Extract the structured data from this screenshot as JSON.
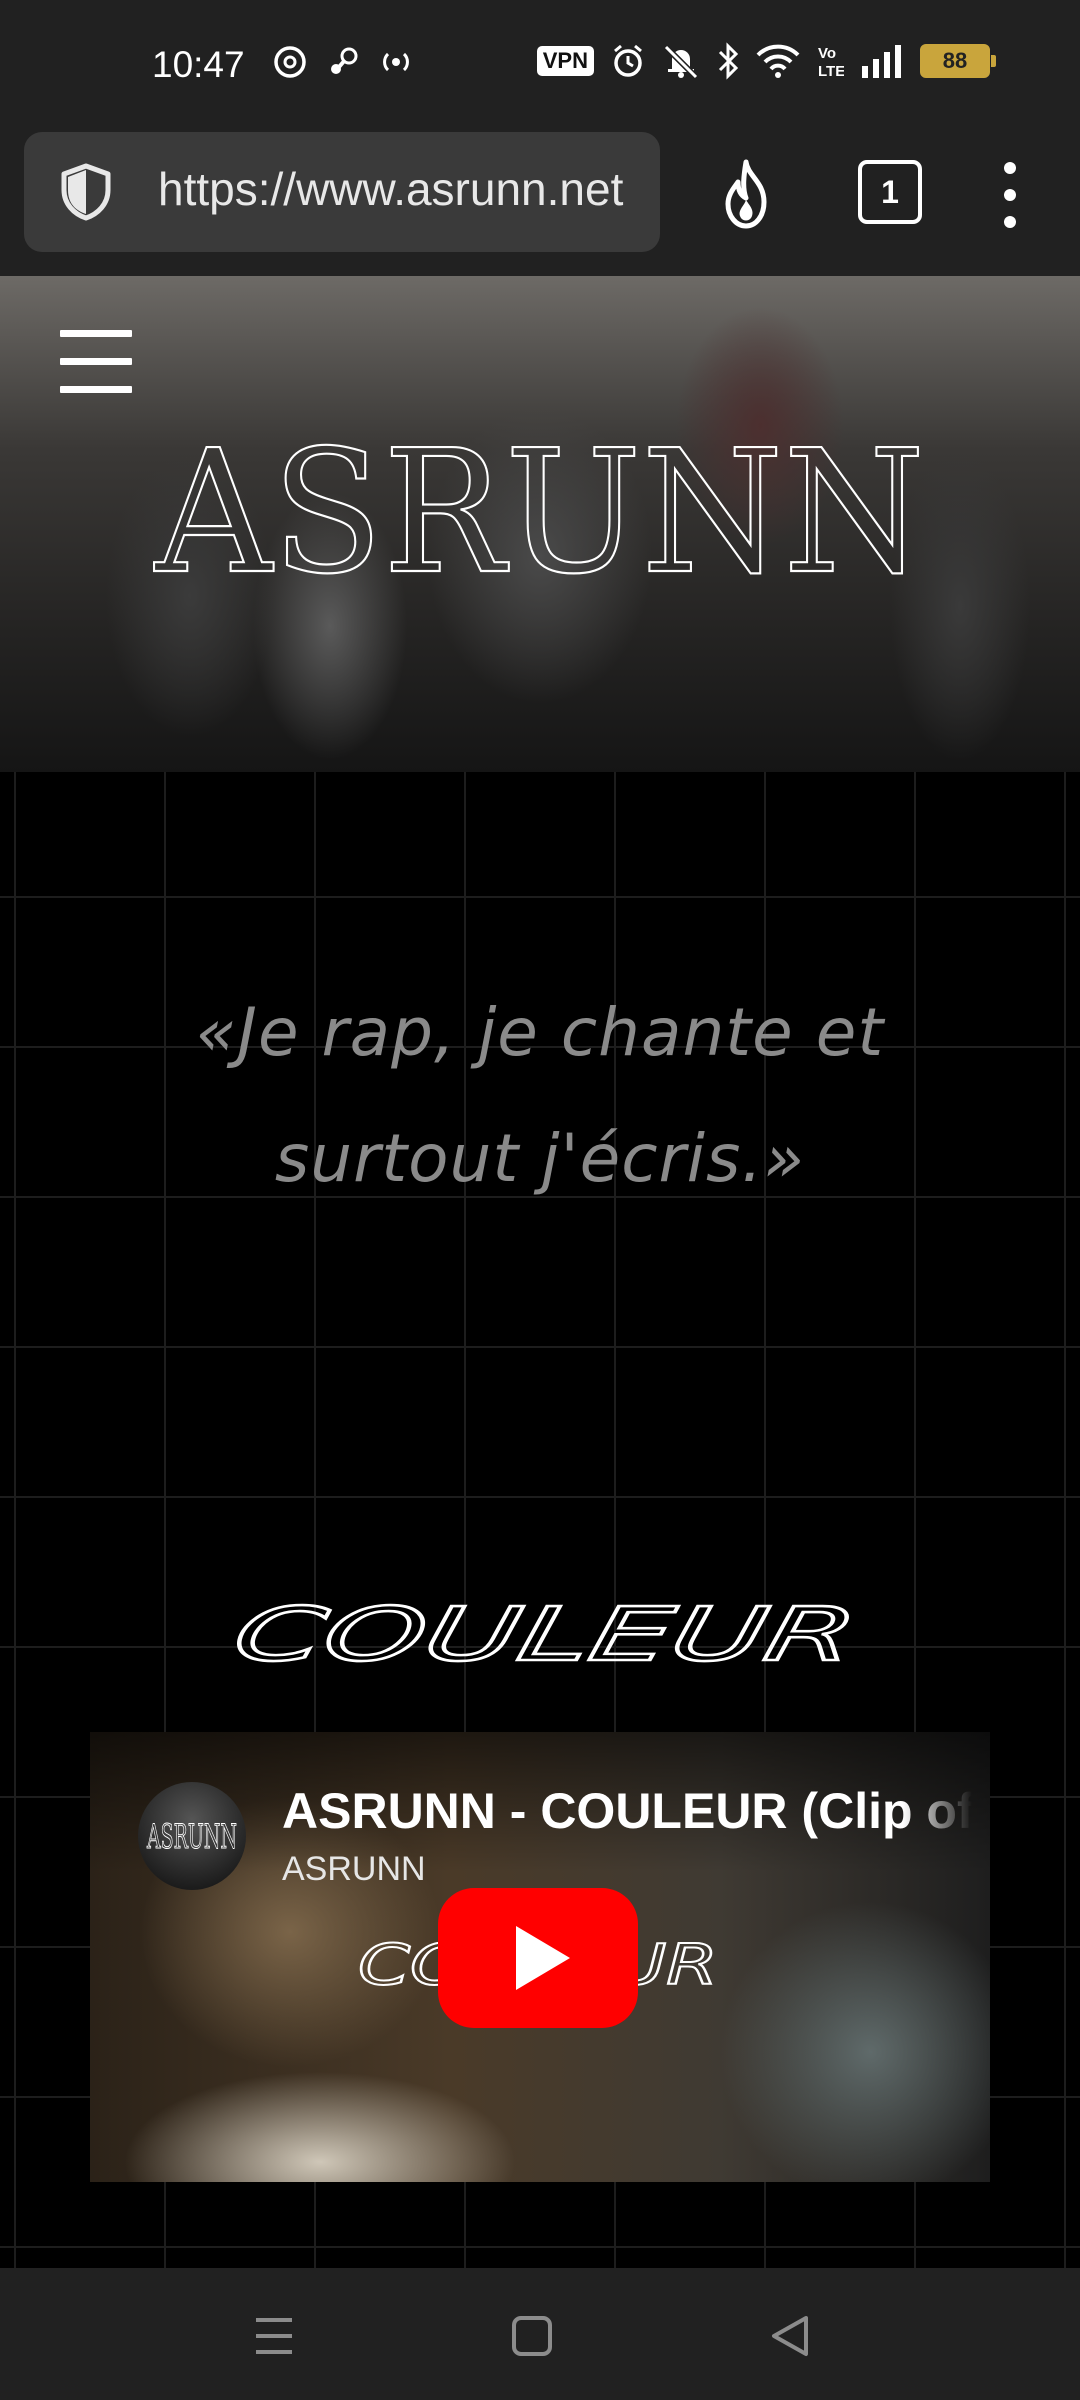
{
  "status_bar": {
    "time": "10:47",
    "vpn_label": "VPN",
    "battery_level": "88",
    "left_icons": [
      "threads-icon",
      "steam-icon",
      "hotspot-icon"
    ],
    "right_icons": [
      "alarm-icon",
      "muted-bell-icon",
      "bluetooth-icon",
      "wifi-icon",
      "volte-icon",
      "signal-icon",
      "battery-icon"
    ]
  },
  "browser": {
    "url": "https://www.asrunn.net",
    "tab_count": "1"
  },
  "hero": {
    "logo_text": "ASRUNN"
  },
  "quote": {
    "line1": "«Je rap, je chante et",
    "line2": "surtout j'écris.»"
  },
  "song": {
    "title": "COULEUR"
  },
  "video": {
    "title": "ASRUNN - COULEUR (Clip officiel)",
    "channel": "ASRUNN",
    "overlay_word": "COULEUR",
    "avatar_text": "ASRUNN"
  },
  "colors": {
    "background": "#000000",
    "chrome": "#212121",
    "quote_text": "#8a8a8a",
    "play_red": "#ff0000",
    "battery": "#c9a53c"
  }
}
